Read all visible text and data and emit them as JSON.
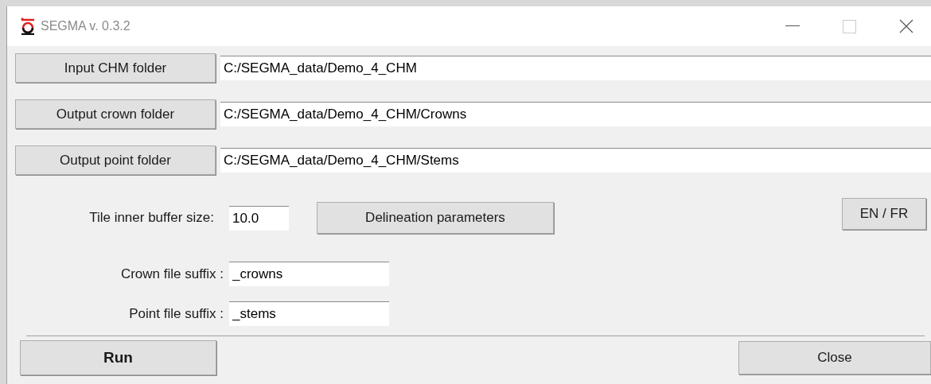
{
  "window": {
    "title": "SEGMA v. 0.3.2"
  },
  "folders": [
    {
      "button": "Input CHM folder",
      "value": "C:/SEGMA_data/Demo_4_CHM"
    },
    {
      "button": "Output crown folder",
      "value": "C:/SEGMA_data/Demo_4_CHM/Crowns"
    },
    {
      "button": "Output point folder",
      "value": "C:/SEGMA_data/Demo_4_CHM/Stems"
    }
  ],
  "buffer": {
    "label": "Tile inner buffer size:",
    "value": "10.0"
  },
  "delineation_button": "Delineation parameters",
  "language_button": "EN / FR",
  "suffixes": [
    {
      "label": "Crown file suffix :",
      "value": "_crowns"
    },
    {
      "label": "Point file suffix :",
      "value": "_stems"
    }
  ],
  "run_button": "Run",
  "close_button": "Close"
}
